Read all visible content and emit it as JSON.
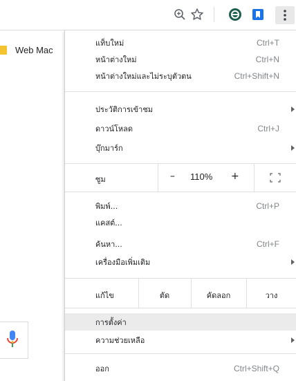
{
  "toolbar": {
    "icons": [
      "zoom-icon",
      "star-icon",
      "extension-icon",
      "bookmark-ext-icon",
      "menu-dots-icon"
    ]
  },
  "bookmarks_bar": {
    "item_label": "Web Mac"
  },
  "menu": {
    "group1": [
      {
        "label": "แท็บใหม่",
        "shortcut": "Ctrl+T"
      },
      {
        "label": "หน้าต่างใหม่",
        "shortcut": "Ctrl+N"
      },
      {
        "label": "หน้าต่างใหม่และไม่ระบุตัวตน",
        "shortcut": "Ctrl+Shift+N"
      }
    ],
    "group2": [
      {
        "label": "ประวัติการเข้าชม",
        "shortcut": ""
      },
      {
        "label": "ดาวน์โหลด",
        "shortcut": "Ctrl+J"
      },
      {
        "label": "บุ๊กมาร์ก",
        "shortcut": ""
      }
    ],
    "zoom": {
      "label": "ซูม",
      "minus": "–",
      "value": "110%",
      "plus": "+"
    },
    "group3": [
      {
        "label": "พิมพ์...",
        "shortcut": "Ctrl+P"
      },
      {
        "label": "แคสต์...",
        "shortcut": ""
      },
      {
        "label": "ค้นหา...",
        "shortcut": "Ctrl+F"
      },
      {
        "label": "เครื่องมือเพิ่มเติม",
        "shortcut": ""
      }
    ],
    "edit": {
      "label": "แก้ไข",
      "cut": "ตัด",
      "copy": "คัดลอก",
      "paste": "วาง"
    },
    "group4": [
      {
        "label": "การตั้งค่า",
        "shortcut": ""
      },
      {
        "label": "ความช่วยเหลือ",
        "shortcut": ""
      }
    ],
    "exit": {
      "label": "ออก",
      "shortcut": "Ctrl+Shift+Q"
    }
  },
  "colors": {
    "extension_green": "#1e5e4e",
    "bookmark_blue": "#1a73e8",
    "folder_yellow": "#f4c430",
    "mic_blue": "#4285f4",
    "mic_red": "#ea4335",
    "mic_yellow": "#fbbc05",
    "mic_green": "#34a853",
    "highlight_row": "#ebebeb"
  }
}
